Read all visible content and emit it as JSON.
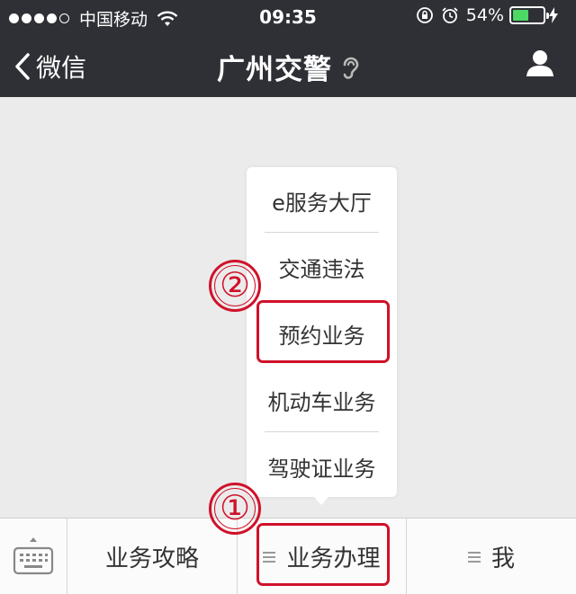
{
  "status_bar": {
    "carrier": "中国移动",
    "time": "09:35",
    "battery_percent": "54%",
    "battery_level": 0.54,
    "colors": {
      "battery_fill": "#4cd964"
    }
  },
  "nav": {
    "back_label": "微信",
    "title": "广州交警"
  },
  "popup_menu": {
    "items": [
      {
        "label": "e服务大厅"
      },
      {
        "label": "交通违法"
      },
      {
        "label": "预约业务"
      },
      {
        "label": "机动车业务"
      },
      {
        "label": "驾驶证业务"
      }
    ]
  },
  "annotations": {
    "step1": "①",
    "step2": "②",
    "color": "#d0112a"
  },
  "bottom_menu": {
    "tabs": [
      {
        "label": "业务攻略"
      },
      {
        "label": "业务办理"
      },
      {
        "label": "我"
      }
    ]
  },
  "icons": [
    "signal-dots-icon",
    "wifi-icon",
    "orientation-lock-icon",
    "alarm-icon",
    "battery-icon",
    "charging-icon",
    "back-chevron-icon",
    "ear-icon",
    "person-icon",
    "keyboard-icon",
    "menu-lines-icon"
  ]
}
